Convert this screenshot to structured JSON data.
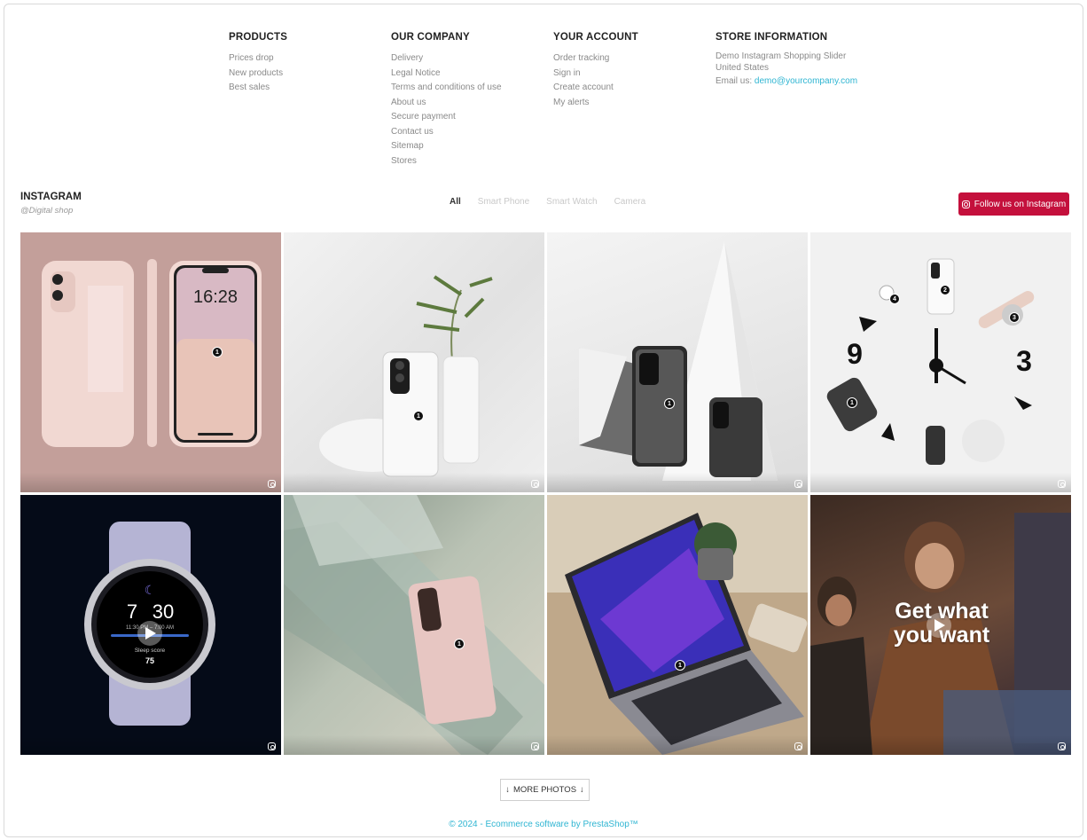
{
  "footer": {
    "products": {
      "title": "PRODUCTS",
      "links": [
        "Prices drop",
        "New products",
        "Best sales"
      ]
    },
    "company": {
      "title": "OUR COMPANY",
      "links": [
        "Delivery",
        "Legal Notice",
        "Terms and conditions of use",
        "About us",
        "Secure payment",
        "Contact us",
        "Sitemap",
        "Stores"
      ]
    },
    "account": {
      "title": "YOUR ACCOUNT",
      "links": [
        "Order tracking",
        "Sign in",
        "Create account",
        "My alerts"
      ]
    },
    "store": {
      "title": "STORE INFORMATION",
      "name": "Demo Instagram Shopping Slider",
      "country": "United States",
      "email_label": "Email us: ",
      "email": "demo@yourcompany.com"
    }
  },
  "instagram": {
    "title": "INSTAGRAM",
    "handle": "@Digital shop",
    "filters": [
      "All",
      "Smart Phone",
      "Smart Watch",
      "Camera"
    ],
    "active_filter": "All",
    "follow_label": "Follow us on Instagram",
    "tiles": [
      {
        "name": "pink-phone",
        "clock": "16:28"
      },
      {
        "name": "white-phone-plant"
      },
      {
        "name": "phone-geometric"
      },
      {
        "name": "flatlay-clock",
        "numerals": [
          "9",
          "3"
        ]
      },
      {
        "name": "smartwatch",
        "time_h": "7",
        "time_m": "30",
        "sub": "11:30 PM – 7:00 AM",
        "sleep_label": "Sleep score",
        "sleep_score": "75"
      },
      {
        "name": "phone-glass-bricks"
      },
      {
        "name": "laptop-desk"
      },
      {
        "name": "video-people",
        "overlay": "Get what you want"
      }
    ],
    "more_label": "MORE PHOTOS"
  },
  "copyright": "© 2024 - Ecommerce software by PrestaShop™",
  "colors": {
    "accent": "#c4103c",
    "link": "#2fb5d2"
  }
}
